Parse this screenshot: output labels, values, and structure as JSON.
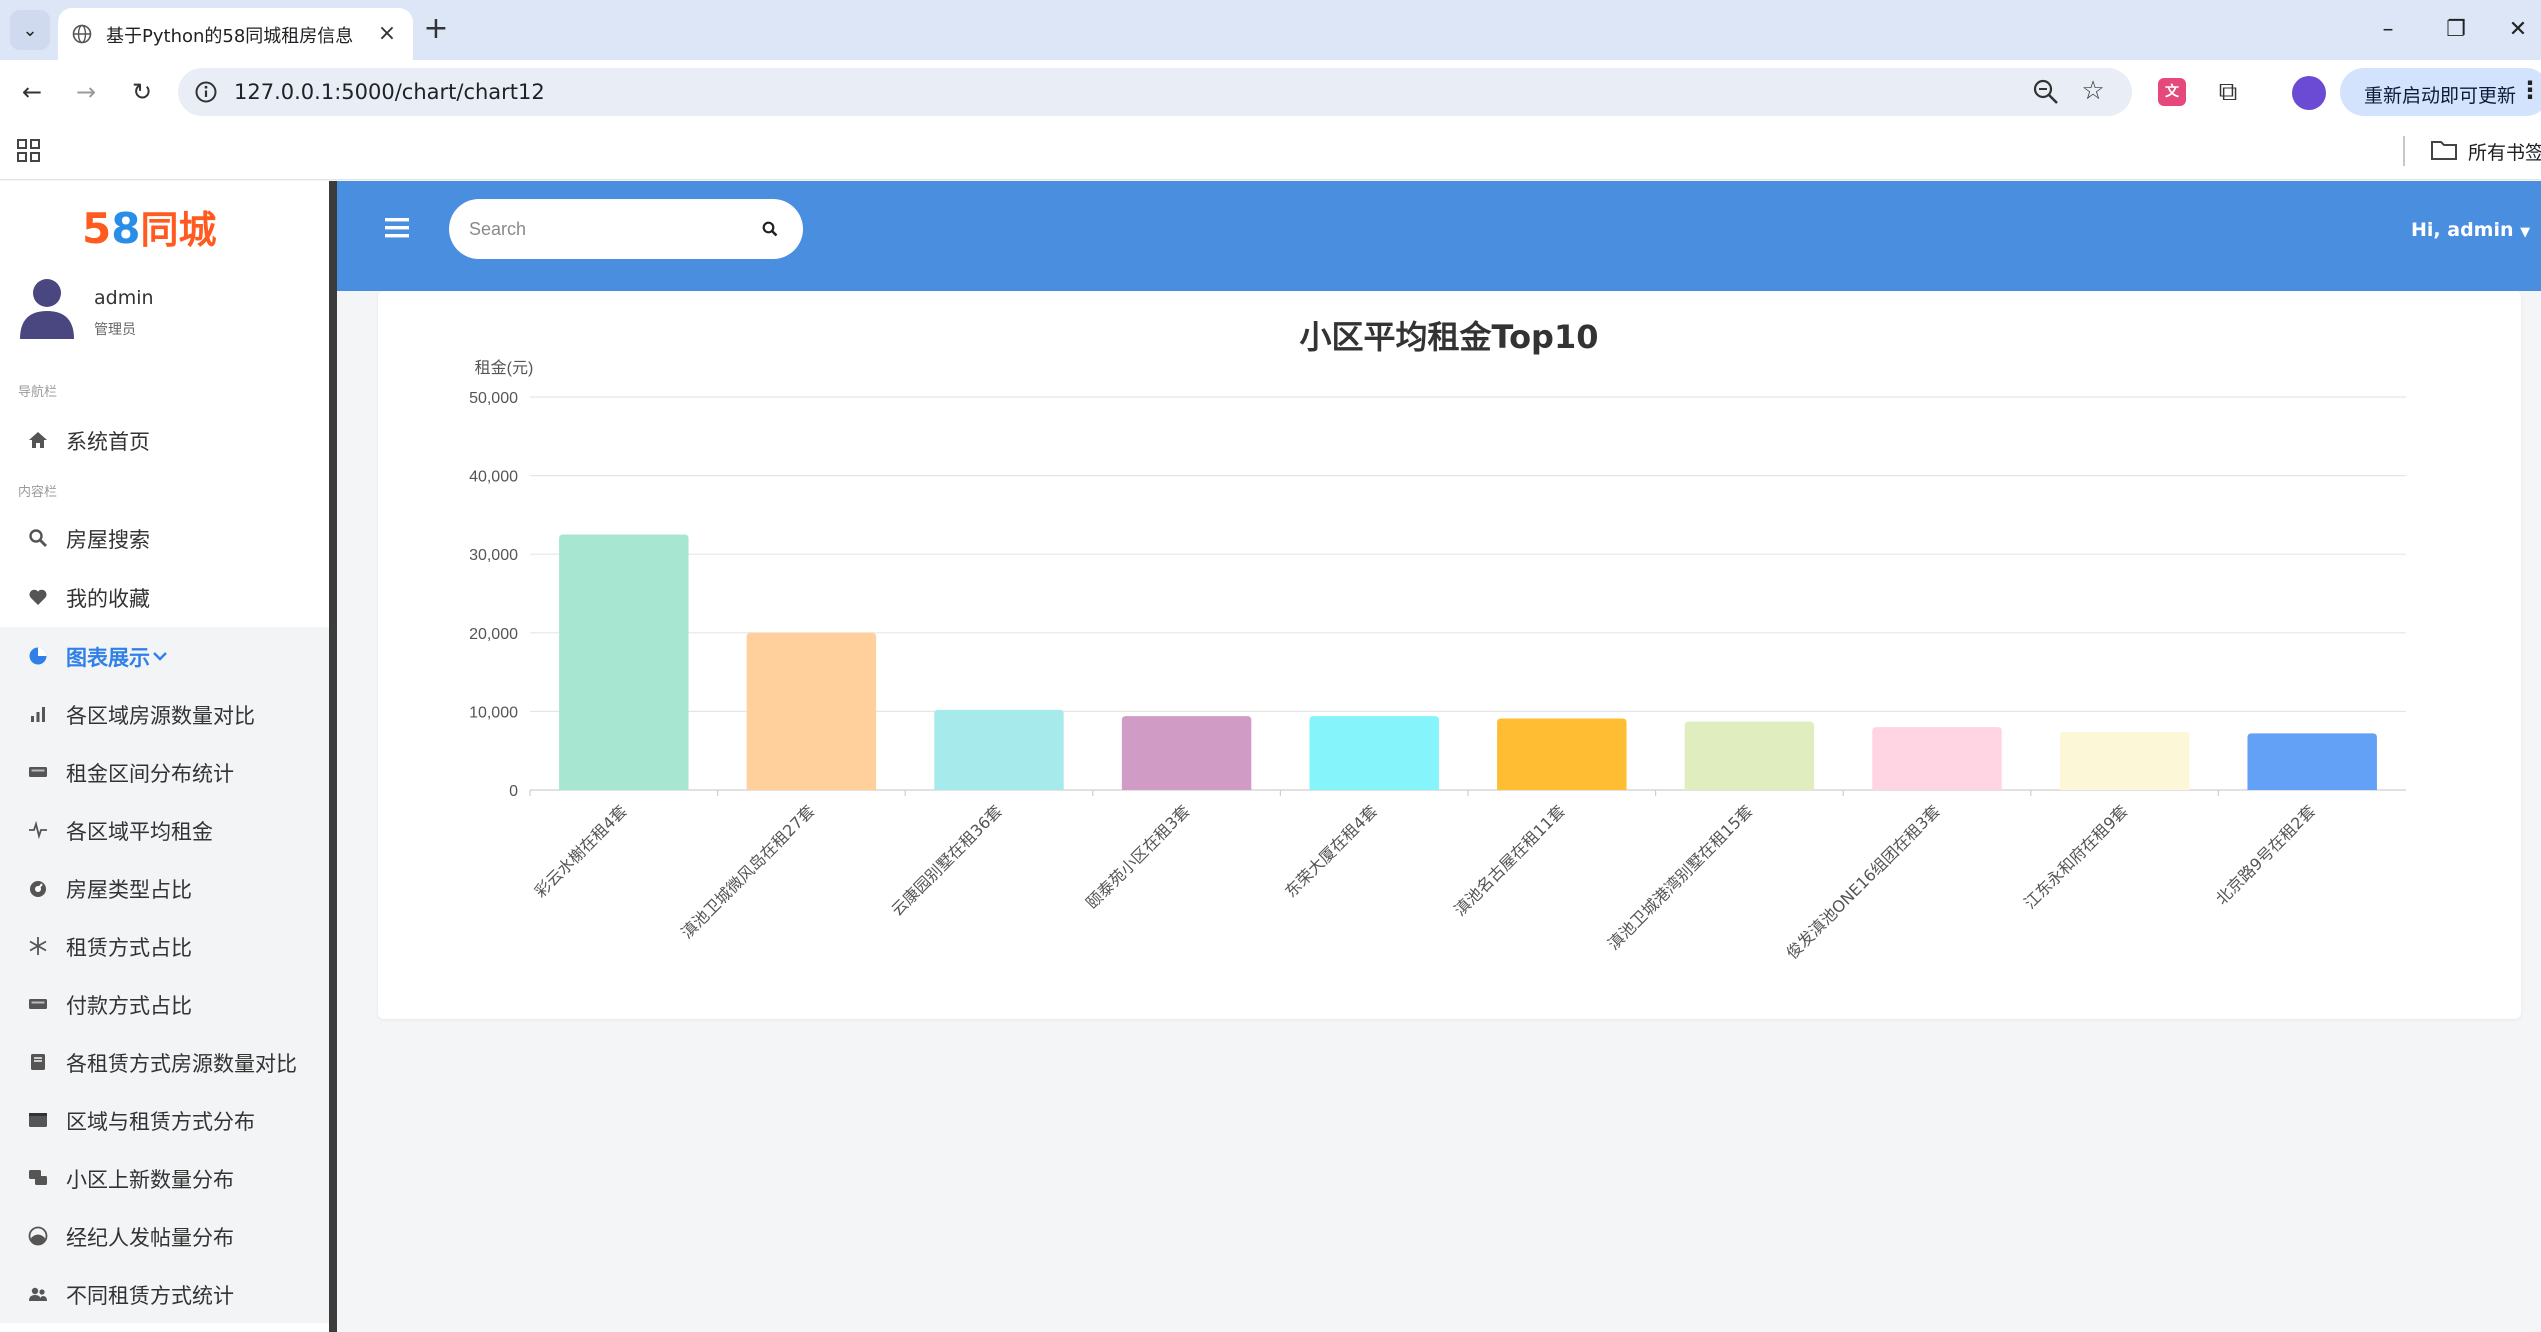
{
  "browser": {
    "tab_title": "基于Python的58同城租房信息",
    "url": "127.0.0.1:5000/chart/chart12",
    "update_button": "重新启动即可更新",
    "bookmarks_folder": "所有书签"
  },
  "sidebar": {
    "logo_digits_5": "5",
    "logo_digits_8": "8",
    "logo_text": "同城",
    "user": {
      "name": "admin",
      "role": "管理员"
    },
    "section_nav": "导航栏",
    "section_content": "内容栏",
    "items": [
      {
        "label": "系统首页",
        "icon": "home-icon"
      },
      {
        "label": "房屋搜索",
        "icon": "search-icon"
      },
      {
        "label": "我的收藏",
        "icon": "heart-icon"
      },
      {
        "label": "图表展示",
        "icon": "pie-chart-icon"
      },
      {
        "label": "各区域房源数量对比",
        "icon": "bar-chart-icon"
      },
      {
        "label": "租金区间分布统计",
        "icon": "keyboard-icon"
      },
      {
        "label": "各区域平均租金",
        "icon": "pulse-icon"
      },
      {
        "label": "房屋类型占比",
        "icon": "gauge-icon"
      },
      {
        "label": "租赁方式占比",
        "icon": "snowflake-icon"
      },
      {
        "label": "付款方式占比",
        "icon": "keyboard-icon"
      },
      {
        "label": "各租赁方式房源数量对比",
        "icon": "book-icon"
      },
      {
        "label": "区域与租赁方式分布",
        "icon": "window-icon"
      },
      {
        "label": "小区上新数量分布",
        "icon": "comments-icon"
      },
      {
        "label": "经纪人发帖量分布",
        "icon": "moon-icon"
      },
      {
        "label": "不同租赁方式统计",
        "icon": "users-icon"
      }
    ]
  },
  "topbar": {
    "search_placeholder": "Search",
    "user_greeting": "Hi, admin"
  },
  "chart_data": {
    "type": "bar",
    "title": "小区平均租金Top10",
    "ylabel": "租金(元)",
    "xlabel": "",
    "ylim": [
      0,
      50000
    ],
    "yticks": [
      "0",
      "10,000",
      "20,000",
      "30,000",
      "40,000",
      "50,000"
    ],
    "grid": true,
    "categories": [
      "彩云水榭在租4套",
      "滇池卫城微风岛在租27套",
      "云康园别墅在租36套",
      "颐泰苑小区在租3套",
      "东荣大厦在租4套",
      "滇池名古屋在租11套",
      "滇池卫城港湾别墅在租15套",
      "俊发滇池ONE16组团在租3套",
      "江东永和府在租9套",
      "北京路9号在租2套"
    ],
    "values": [
      32500,
      20000,
      10200,
      9400,
      9400,
      9100,
      8700,
      8000,
      7400,
      7200
    ],
    "colors": [
      "#a7e6d0",
      "#ffd09c",
      "#a7eaeb",
      "#d09bc4",
      "#85f4fb",
      "#ffbd33",
      "#dfedbf",
      "#ffd5e3",
      "#fcf7d6",
      "#62a1f5"
    ]
  }
}
